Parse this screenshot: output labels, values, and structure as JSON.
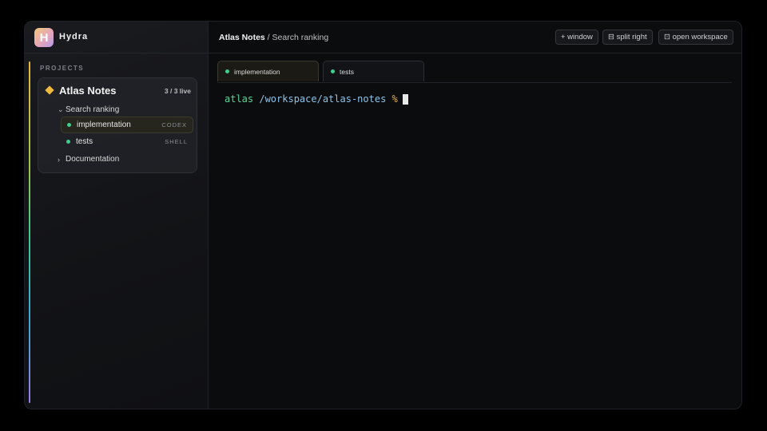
{
  "app": {
    "brand_initial": "H",
    "brand_name": "Hydra"
  },
  "sidebar": {
    "section_label": "PROJECTS",
    "project": {
      "name": "Atlas Notes",
      "live_count": "3 / 3 live",
      "groups": [
        {
          "name": "Search ranking",
          "expanded": true,
          "sessions": [
            {
              "name": "implementation",
              "tag": "CODEX",
              "active": true,
              "status_color": "#3ecf8e"
            },
            {
              "name": "tests",
              "tag": "SHELL",
              "active": false,
              "status_color": "#3ecf8e"
            }
          ]
        },
        {
          "name": "Documentation",
          "expanded": false
        }
      ]
    }
  },
  "topbar": {
    "breadcrumb_project": "Atlas Notes",
    "breadcrumb_separator": " / ",
    "breadcrumb_group": "Search ranking",
    "buttons": {
      "window": "+ window",
      "split_right": "⊟ split right",
      "open_workspace": "⊡ open workspace"
    }
  },
  "tabs": [
    {
      "label": "implementation",
      "active": true
    },
    {
      "label": "tests",
      "active": false
    }
  ],
  "terminal": {
    "user": "atlas",
    "path": "/workspace/atlas-notes",
    "prompt": "%"
  },
  "colors": {
    "accent": "#f0bb3c",
    "status_live": "#3ecf8e",
    "terminal_user": "#5ed39a",
    "terminal_path": "#8ec3e8"
  }
}
